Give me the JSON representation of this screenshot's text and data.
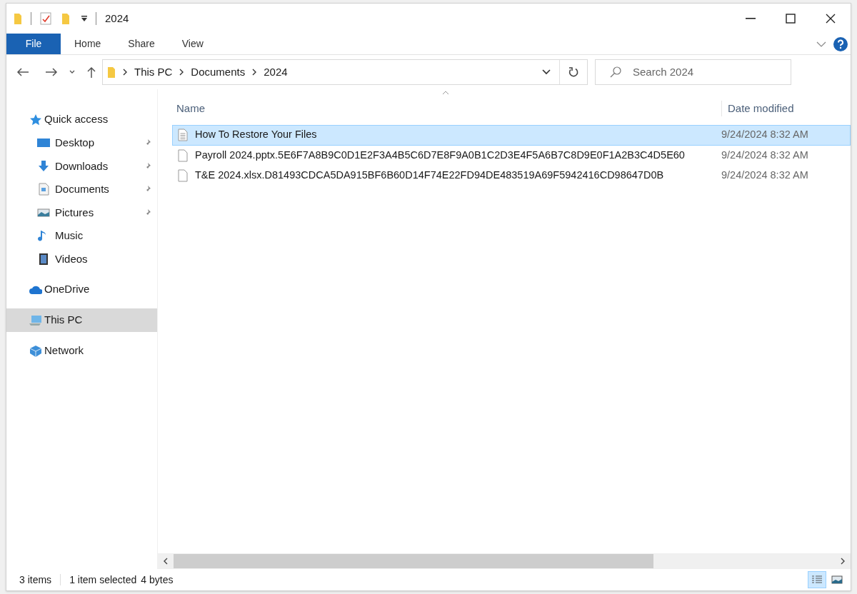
{
  "window": {
    "title": "2024"
  },
  "ribbon": {
    "file_tab": {
      "label": "File"
    },
    "tabs": [
      {
        "label": "Home"
      },
      {
        "label": "Share"
      },
      {
        "label": "View"
      }
    ]
  },
  "address": {
    "path": [
      "This PC",
      "Documents",
      "2024"
    ]
  },
  "search": {
    "placeholder": "Search 2024"
  },
  "sidebar": {
    "items": [
      {
        "label": "Quick access",
        "kind": "star",
        "selected": false,
        "children": [
          {
            "label": "Desktop",
            "kind": "desktop",
            "pinned": true
          },
          {
            "label": "Downloads",
            "kind": "download",
            "pinned": true
          },
          {
            "label": "Documents",
            "kind": "documents",
            "pinned": true
          },
          {
            "label": "Pictures",
            "kind": "pictures",
            "pinned": true
          },
          {
            "label": "Music",
            "kind": "music",
            "pinned": false
          },
          {
            "label": "Videos",
            "kind": "videos",
            "pinned": false
          }
        ]
      },
      {
        "label": "OneDrive",
        "kind": "cloud",
        "selected": false
      },
      {
        "label": "This PC",
        "kind": "pc",
        "selected": true
      },
      {
        "label": "Network",
        "kind": "network",
        "selected": false
      }
    ]
  },
  "table": {
    "columns": [
      "Name",
      "Date modified"
    ],
    "rows": [
      {
        "name": "How To Restore Your Files",
        "date": "9/24/2024 8:32 AM",
        "selected": true,
        "kind": "text"
      },
      {
        "name": "Payroll 2024.pptx.5E6F7A8B9C0D1E2F3A4B5C6D7E8F9A0B1C2D3E4F5A6B7C8D9E0F1A2B3C4D5E60",
        "date": "9/24/2024 8:32 AM",
        "selected": false,
        "kind": "blank"
      },
      {
        "name": "T&E 2024.xlsx.D81493CDCA5DA915BF6B60D14F74E22FD94DE483519A69F5942416CD98647D0B",
        "date": "9/24/2024 8:32 AM",
        "selected": false,
        "kind": "blank"
      }
    ]
  },
  "status_bar": {
    "count": "3 items",
    "selection": "1 item selected",
    "size": "4 bytes"
  },
  "view_buttons": [
    {
      "kind": "details",
      "selected": true
    },
    {
      "kind": "tiles",
      "selected": false
    }
  ]
}
